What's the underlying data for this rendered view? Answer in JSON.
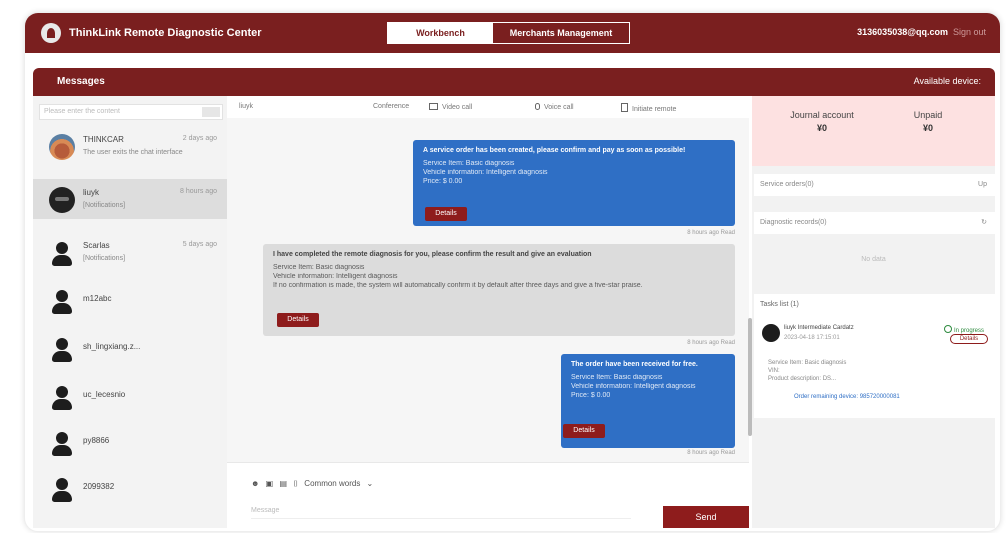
{
  "header": {
    "app_title": "ThinkLink Remote Diagnostic Center",
    "tab_workbench": "Workbench",
    "tab_merchants": "Merchants Management",
    "user_email": "3136035038@qq.com",
    "sign_out": "Sign out"
  },
  "messages_bar": {
    "title": "Messages",
    "available_device": "Available device:"
  },
  "contacts": {
    "search_placeholder": "Please enter the content",
    "items": [
      {
        "name": "THINKCAR",
        "time": "2 days ago",
        "preview": "The user exits the chat interface"
      },
      {
        "name": "liuyk",
        "time": "8 hours ago",
        "preview": "[Notifications]"
      },
      {
        "name": "Scarlas",
        "time": "5 days ago",
        "preview": "[Notifications]"
      },
      {
        "name": "m12abc",
        "time": "",
        "preview": ""
      },
      {
        "name": "sh_lingxiang.z...",
        "time": "",
        "preview": ""
      },
      {
        "name": "uc_lecesnio",
        "time": "",
        "preview": ""
      },
      {
        "name": "py8866",
        "time": "",
        "preview": ""
      },
      {
        "name": "2099382",
        "time": "",
        "preview": ""
      }
    ]
  },
  "chat": {
    "peer": "liuyk",
    "toolbar": {
      "conference": "Conference",
      "video_call": "Video call",
      "voice_call": "Voice call",
      "initiate_remote": "Initiate remote"
    },
    "msg1": {
      "head": "A service order has been created, please confirm and pay as soon as possible!",
      "service": "Service Item: Basic diagnosis",
      "vehicle": "Vehicle information: Intelligent diagnosis",
      "price": "Price: $ 0.00",
      "details": "Details",
      "stamp": "8 hours ago Read"
    },
    "msg2": {
      "head": "I have completed the remote diagnosis for you, please confirm the result and give an evaluation",
      "service": "Service Item: Basic diagnosis",
      "vehicle": "Vehicle information: Intelligent diagnosis",
      "note": "If no confirmation is made, the system will automatically confirm it by default after three days and give a five-star praise.",
      "details": "Details",
      "stamp": "8 hours ago Read"
    },
    "msg3": {
      "head": "The order have been received for free.",
      "service": "Service Item: Basic diagnosis",
      "vehicle": "Vehicle information: Intelligent diagnosis",
      "price": "Price: $ 0.00",
      "details": "Details",
      "stamp": "8 hours ago Read"
    },
    "composer": {
      "common_words": "Common words",
      "placeholder": "Message",
      "send": "Send"
    }
  },
  "right_panel": {
    "journal_label": "Journal account",
    "journal_value": "¥0",
    "unpaid_label": "Unpaid",
    "unpaid_value": "¥0",
    "service_orders": "Service orders(0)",
    "service_orders_action": "Up",
    "diagnostic_records": "Diagnostic records(0)",
    "no_data": "No data",
    "tasks_header": "Tasks list (1)",
    "task": {
      "name": "liuyk Intermediate Cardatz",
      "date": "2023-04-18 17:15:01",
      "status": "In progress",
      "details": "Details",
      "service": "Service Item: Basic diagnosis",
      "vin": "VIN:",
      "product": "Product description: DS...",
      "link": "Order remaining device: 985720000081"
    }
  }
}
